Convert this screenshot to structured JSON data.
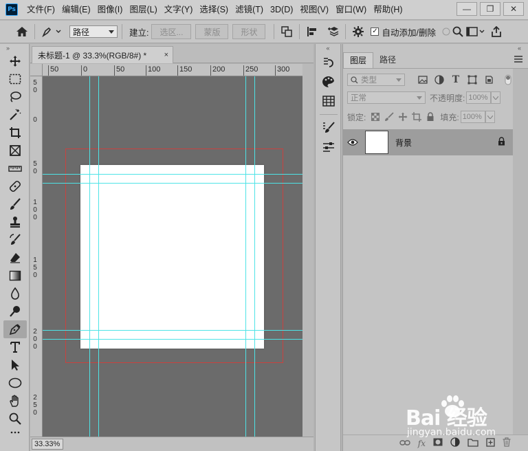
{
  "app": {
    "logo": "Ps"
  },
  "menu": [
    "文件(F)",
    "编辑(E)",
    "图像(I)",
    "图层(L)",
    "文字(Y)",
    "选择(S)",
    "滤镜(T)",
    "3D(D)",
    "视图(V)",
    "窗口(W)",
    "帮助(H)"
  ],
  "window_controls": {
    "minimize": "—",
    "restore": "❐",
    "close": "✕"
  },
  "options": {
    "mode_value": "路径",
    "build_label": "建立:",
    "selection_btn": "选区...",
    "mask_btn": "蒙版",
    "shape_btn": "形状",
    "auto_add_label": "自动添加/删除",
    "auto_add_checked": true
  },
  "document": {
    "tab_title": "未标题-1 @ 33.3%(RGB/8#) *",
    "tab_close": "×",
    "zoom": "33.33%"
  },
  "rulers": {
    "h_labels": [
      "50",
      "0",
      "50",
      "100",
      "150",
      "200",
      "250",
      "300"
    ],
    "v_labels": [
      "5 0",
      "0",
      "5 0",
      "1 0 0",
      "1 5 0",
      "2 0 0",
      "2 5 0"
    ]
  },
  "layers_panel": {
    "tabs": [
      "图层",
      "路径"
    ],
    "active_tab": "图层",
    "filter_placeholder": "类型",
    "blend_mode": "正常",
    "opacity_label": "不透明度:",
    "opacity_value": "100%",
    "lock_label": "锁定:",
    "fill_label": "填充:",
    "fill_value": "100%",
    "layers": [
      {
        "name": "背景",
        "visible": true,
        "locked": true
      }
    ]
  },
  "watermark": {
    "text": "Bai 经验",
    "sub": "jingyan.baidu.com"
  },
  "colors": {
    "guide": "#4ee3e6",
    "bleed": "#c9413f",
    "canvas_bg": "#6b6b6b"
  }
}
